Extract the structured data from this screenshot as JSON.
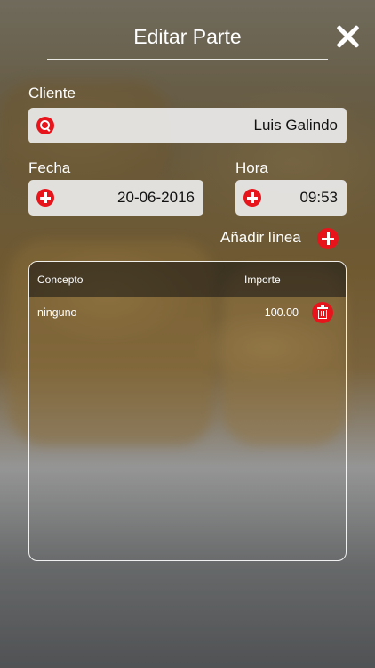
{
  "header": {
    "title": "Editar Parte",
    "close_icon": "close-icon"
  },
  "cliente": {
    "label": "Cliente",
    "value": "Luis Galindo",
    "icon": "search-icon"
  },
  "fecha": {
    "label": "Fecha",
    "value": "20-06-2016",
    "icon": "plus-icon"
  },
  "hora": {
    "label": "Hora",
    "value": "09:53",
    "icon": "plus-icon"
  },
  "add_line": {
    "label": "Añadir línea",
    "icon": "plus-icon"
  },
  "table": {
    "columns": [
      "Concepto",
      "Importe"
    ],
    "rows": [
      {
        "concepto": "ninguno",
        "importe": "100.00",
        "action_icon": "trash-icon"
      }
    ]
  },
  "colors": {
    "accent": "#e8141c",
    "field_bg": "#ebebeb"
  }
}
